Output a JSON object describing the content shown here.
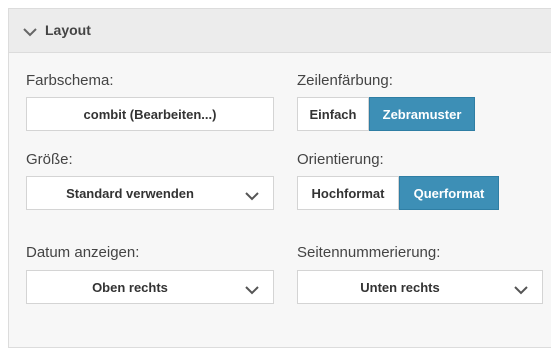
{
  "section": {
    "title": "Layout",
    "collapse_icon": "chevron-down-icon"
  },
  "color_scheme": {
    "label": "Farbschema:",
    "button": "combit (Bearbeiten...)"
  },
  "row_coloring": {
    "label": "Zeilenfärbung:",
    "options": [
      "Einfach",
      "Zebramuster"
    ],
    "selected": "Zebramuster"
  },
  "size": {
    "label": "Größe:",
    "value": "Standard verwenden"
  },
  "orientation": {
    "label": "Orientierung:",
    "options": [
      "Hochformat",
      "Querformat"
    ],
    "selected": "Querformat"
  },
  "date": {
    "label": "Datum anzeigen:",
    "value": "Oben rechts"
  },
  "page_numbering": {
    "label": "Seitennummerierung:",
    "value": "Unten rechts"
  },
  "colors": {
    "accent": "#3d8fb6",
    "panel_bg": "#f7f7f7",
    "header_bg": "#ececec"
  }
}
